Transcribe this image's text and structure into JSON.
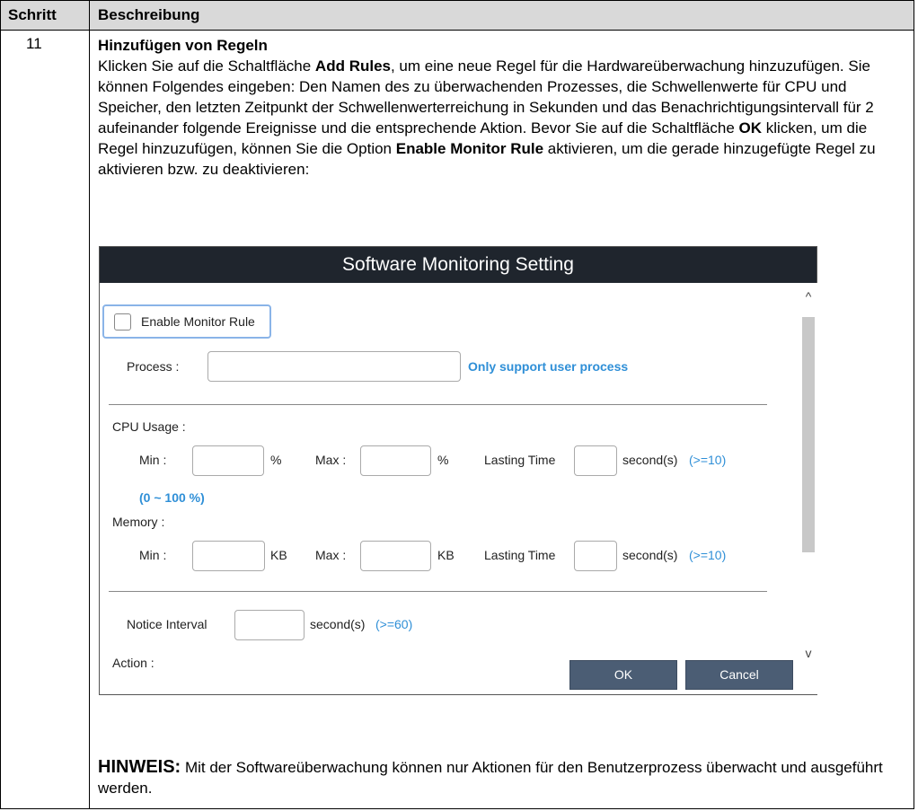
{
  "table": {
    "header_step": "Schritt",
    "header_description": "Beschreibung"
  },
  "step": {
    "number": "11",
    "title": "Hinzufügen von Regeln",
    "text_1": "Klicken Sie auf die Schaltfläche ",
    "add_rules": "Add Rules",
    "text_2": ", um eine neue Regel für die Hardwareüberwachung hinzuzufügen. Sie können Folgendes eingeben: Den Namen des zu überwachenden Prozesses, die Schwellenwerte für CPU und Speicher, den letzten Zeitpunkt der Schwellenwerterreichung in Sekunden und das Benachrichtigungsintervall für 2 aufeinander folgende Ereignisse und die entsprechende Aktion. Bevor Sie auf die Schaltfläche ",
    "ok": "OK",
    "text_3": " klicken, um die Regel hinzuzufügen, können Sie die Option ",
    "enable_rule": "Enable Monitor Rule",
    "text_4": " aktivieren, um die gerade hinzugefügte Regel zu aktivieren bzw. zu deaktivieren:"
  },
  "dialog": {
    "title": "Software Monitoring Setting",
    "enable_label": "Enable Monitor Rule",
    "process_label": "Process :",
    "process_value": "",
    "process_hint": "Only support user process",
    "cpu_label": "CPU Usage :",
    "min_label": "Min :",
    "max_label": "Max :",
    "percent": "%",
    "kb": "KB",
    "lasting_label": "Lasting Time",
    "seconds": "second(s)",
    "ge10": "(>=10)",
    "cpu_range": "(0 ~ 100 %)",
    "memory_label": "Memory :",
    "notice_label": "Notice Interval",
    "ge60": "(>=60)",
    "action_label": "Action :",
    "ok_button": "OK",
    "cancel_button": "Cancel",
    "scroll_up": "^",
    "scroll_down": "v"
  },
  "note": {
    "keyword": "HINWEIS:",
    "text": " Mit der Softwareüberwachung können nur Aktionen für den Benutzerprozess überwacht und ausgeführt werden."
  }
}
